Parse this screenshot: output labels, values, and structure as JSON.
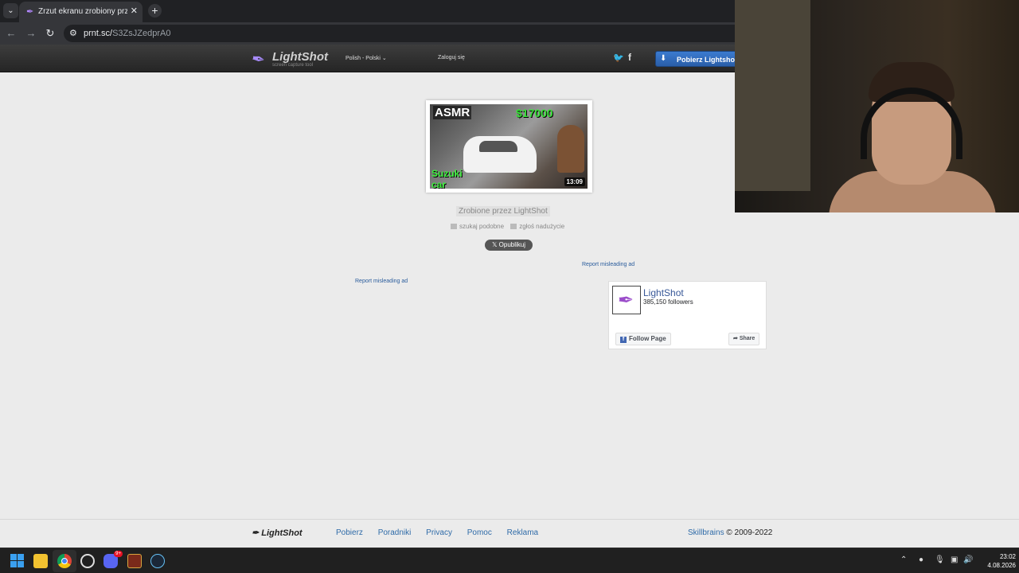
{
  "browser": {
    "tab_title": "Zrzut ekranu zrobiony przez Lig",
    "url_host": "prnt.sc/",
    "url_path": "S3ZsJZedprA0"
  },
  "header": {
    "logo": "LightShot",
    "logo_sub": "screen capture tool",
    "language": "Polish - Polski",
    "login": "Zaloguj się",
    "download": "Pobierz Lightshot z"
  },
  "screenshot": {
    "asmr": "ASMR",
    "price": "$17000",
    "model": "Suzuki car",
    "duration": "13:09"
  },
  "content": {
    "made_by": "Zrobione przez LightShot",
    "search_similar": "szukaj podobne",
    "report_abuse": "zgłoś nadużycie",
    "publish": "Opublikuj",
    "report_ad_1": "Report misleading ad",
    "report_ad_2": "Report misleading ad"
  },
  "fb_widget": {
    "name": "LightShot",
    "followers": "385,150 followers",
    "follow": "Follow Page",
    "share": "Share"
  },
  "footer": {
    "logo": "LightShot",
    "links": [
      "Pobierz",
      "Poradniki",
      "Privacy",
      "Pomoc",
      "Reklama"
    ],
    "brand": "Skillbrains",
    "copyright": "© 2009-2022"
  },
  "taskbar": {
    "discord_badge": "9+",
    "time": "23:02",
    "date": "4.08.2026"
  },
  "colors": {
    "accent": "#2a5c9c",
    "download_button": "#3b7bd0",
    "page_background": "#ebebeb"
  }
}
